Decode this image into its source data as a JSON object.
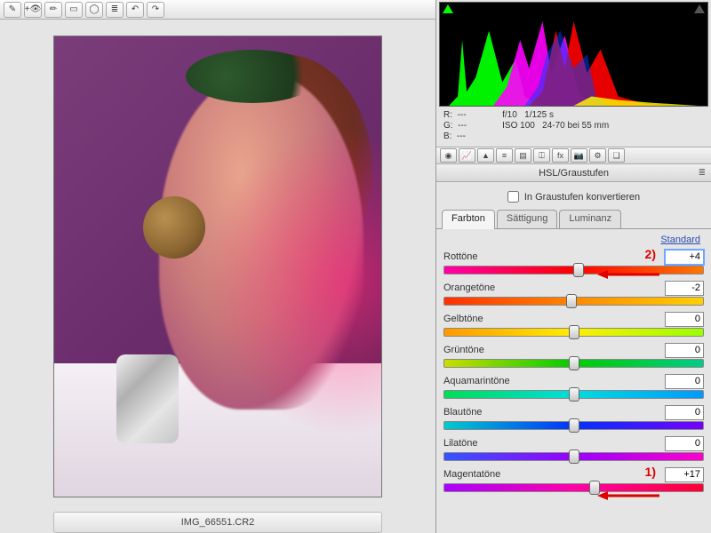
{
  "toolbar_icons": [
    "crop",
    "eye",
    "brush",
    "rect",
    "oval",
    "list",
    "rotate-ccw",
    "rotate-cw"
  ],
  "filename": "IMG_66551.CR2",
  "histogram": {
    "info_left": {
      "R": "---",
      "G": "---",
      "B": "---"
    },
    "info_right": {
      "aperture": "f/10",
      "shutter": "1/125 s",
      "iso": "ISO 100",
      "lens": "24-70 bei 55 mm"
    }
  },
  "panel_tools": [
    "aperture",
    "curve",
    "sharpen",
    "bw",
    "split",
    "lens",
    "fx",
    "camera",
    "sliders",
    "presets"
  ],
  "panel_title": "HSL/Graustufen",
  "grayscale_label": "In Graustufen konvertieren",
  "tabs": {
    "hue": "Farbton",
    "sat": "Sättigung",
    "lum": "Luminanz"
  },
  "default_label": "Standard",
  "sliders": {
    "red": {
      "label": "Rottöne",
      "value": "+4",
      "pos": 52
    },
    "orange": {
      "label": "Orangetöne",
      "value": "-2",
      "pos": 49
    },
    "yellow": {
      "label": "Gelbtöne",
      "value": "0",
      "pos": 50
    },
    "green": {
      "label": "Grüntöne",
      "value": "0",
      "pos": 50
    },
    "aqua": {
      "label": "Aquamarintöne",
      "value": "0",
      "pos": 50
    },
    "blue": {
      "label": "Blautöne",
      "value": "0",
      "pos": 50
    },
    "purple": {
      "label": "Lilatöne",
      "value": "0",
      "pos": 50
    },
    "magenta": {
      "label": "Magentatöne",
      "value": "+17",
      "pos": 58
    }
  },
  "annotations": {
    "a1": "1)",
    "a2": "2)"
  }
}
